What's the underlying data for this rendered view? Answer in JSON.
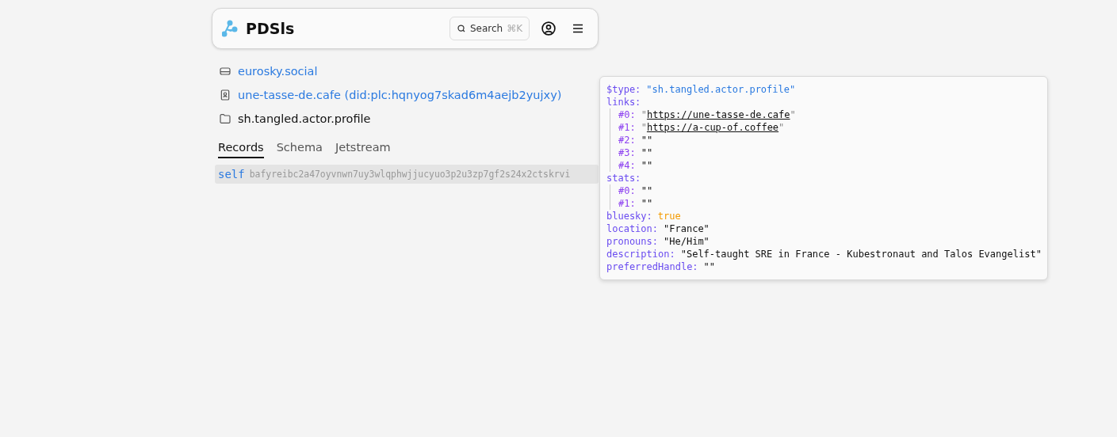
{
  "header": {
    "title": "PDSls",
    "search": {
      "label": "Search",
      "shortcut": "⌘K"
    }
  },
  "breadcrumbs": [
    {
      "kind": "server",
      "label": "eurosky.social",
      "link": true
    },
    {
      "kind": "account",
      "label": "une-tasse-de.cafe (did:plc:hqnyog7skad6m4aejb2yujxy)",
      "link": true
    },
    {
      "kind": "collection",
      "label": "sh.tangled.actor.profile",
      "link": false
    }
  ],
  "tabs": [
    {
      "label": "Records",
      "selected": true
    },
    {
      "label": "Schema",
      "selected": false
    },
    {
      "label": "Jetstream",
      "selected": false
    }
  ],
  "records": [
    {
      "key": "self",
      "cid": "bafyreibc2a47oyvnwn7uy3wlqphwjjucyuo3p2u3zp7gf2s24x2ctskrvi",
      "hovered": true
    }
  ],
  "preview": [
    {
      "key": "$type:",
      "kind": "type",
      "value": "\"sh.tangled.actor.profile\""
    },
    {
      "key": "links:",
      "kind": "array",
      "children": [
        {
          "key": "#0:",
          "kind": "link",
          "open": "\"",
          "value": "https://une-tasse-de.cafe",
          "close": "\""
        },
        {
          "key": "#1:",
          "kind": "link",
          "open": "\"",
          "value": "https://a-cup-of.coffee",
          "close": "\""
        },
        {
          "key": "#2:",
          "kind": "string",
          "value": "\"\""
        },
        {
          "key": "#3:",
          "kind": "string",
          "value": "\"\""
        },
        {
          "key": "#4:",
          "kind": "string",
          "value": "\"\""
        }
      ]
    },
    {
      "key": "stats:",
      "kind": "array",
      "children": [
        {
          "key": "#0:",
          "kind": "string",
          "value": "\"\""
        },
        {
          "key": "#1:",
          "kind": "string",
          "value": "\"\""
        }
      ]
    },
    {
      "key": "bluesky:",
      "kind": "boolean",
      "value": "true"
    },
    {
      "key": "location:",
      "kind": "string",
      "value": "\"France\""
    },
    {
      "key": "pronouns:",
      "kind": "string",
      "value": "\"He/Him\""
    },
    {
      "key": "description:",
      "kind": "string",
      "value": "\"Self-taught SRE in France - Kubestronaut and Talos Evangelist\""
    },
    {
      "key": "preferredHandle:",
      "kind": "string",
      "value": "\"\""
    }
  ]
}
